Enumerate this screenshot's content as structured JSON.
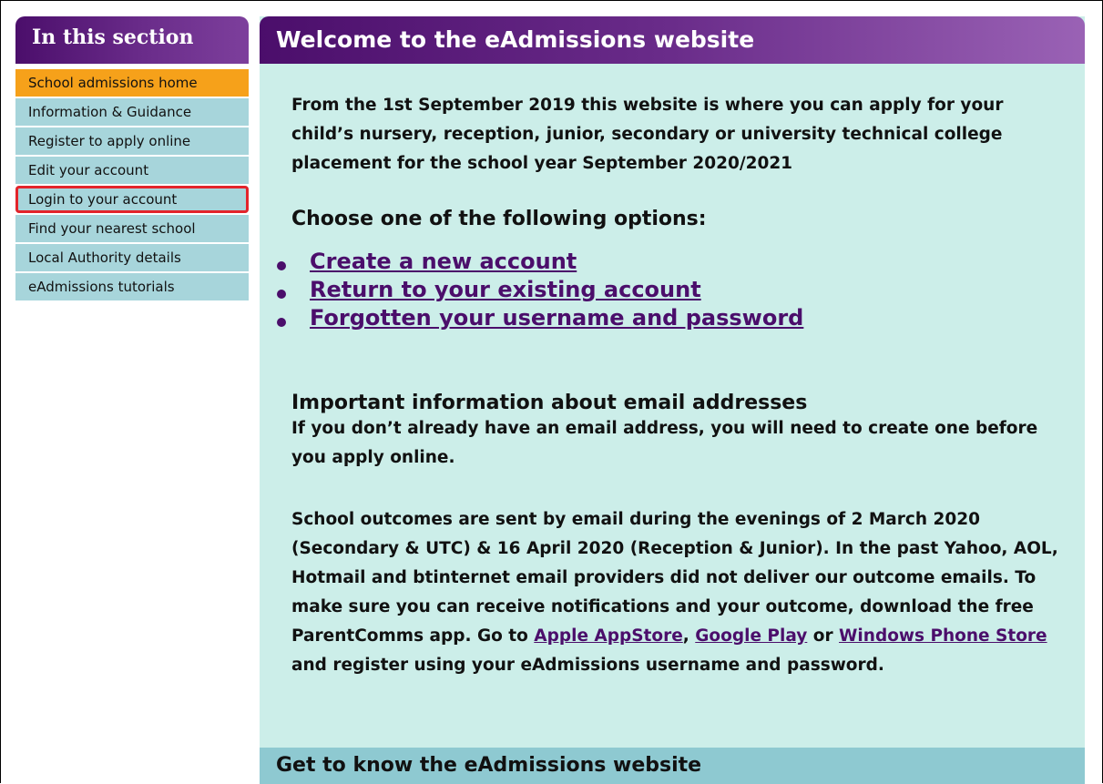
{
  "sidebar": {
    "title": "In this section",
    "items": [
      {
        "label": "School admissions home"
      },
      {
        "label": "Information & Guidance"
      },
      {
        "label": "Register to apply online"
      },
      {
        "label": "Edit your account"
      },
      {
        "label": "Login to your account"
      },
      {
        "label": "Find your nearest school"
      },
      {
        "label": "Local Authority details"
      },
      {
        "label": "eAdmissions tutorials"
      }
    ]
  },
  "main": {
    "title": "Welcome to the eAdmissions website",
    "intro": "From the 1st September 2019 this website is where you can apply for your child’s nursery, reception, junior, secondary or university technical college placement for the school year September 2020/2021",
    "choose_heading": "Choose one of the following options:",
    "options": [
      {
        "label": "Create a new account"
      },
      {
        "label": "Return to your existing account"
      },
      {
        "label": "Forgotten your username and password"
      }
    ],
    "important_heading": "Important information about email addresses",
    "email_note": "If you don’t already have an email address, you will need to create one before you apply online.",
    "outcomes_text_1": "School outcomes are sent by email during the evenings of 2 March 2020 (Secondary & UTC) & 16 April 2020 (Reception & Junior). In the past Yahoo, AOL, Hotmail and btinternet email providers did not deliver our outcome emails. To make sure you can receive notifications and your outcome, download the free ParentComms app. Go to ",
    "link_apple": "Apple AppStore",
    "sep_1": ", ",
    "link_google": "Google Play",
    "sep_2": " or ",
    "link_windows": "Windows Phone Store",
    "outcomes_text_2": " and register using your eAdmissions username and password.",
    "bottom_bar_title": "Get to know the eAdmissions website"
  }
}
